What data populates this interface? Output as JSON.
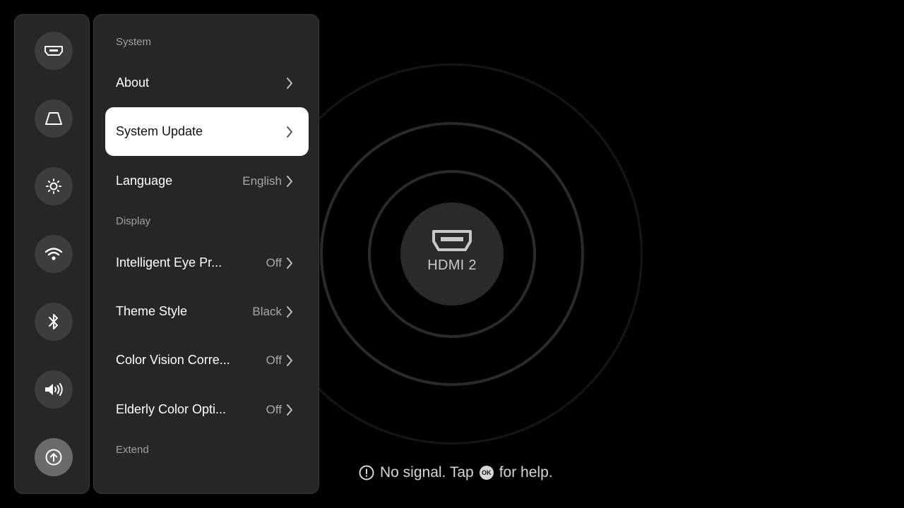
{
  "rail": {
    "buttons": [
      {
        "id": "input",
        "icon": "hdmi-icon"
      },
      {
        "id": "keystone",
        "icon": "keystone-icon"
      },
      {
        "id": "brightness",
        "icon": "brightness-icon"
      },
      {
        "id": "wifi",
        "icon": "wifi-icon"
      },
      {
        "id": "bluetooth",
        "icon": "bluetooth-icon"
      },
      {
        "id": "sound",
        "icon": "speaker-icon"
      },
      {
        "id": "system",
        "icon": "arrow-up-circle-icon",
        "active": true
      }
    ]
  },
  "panel": {
    "sections": {
      "system": "System",
      "display": "Display",
      "extend": "Extend"
    },
    "items": {
      "about": {
        "label": "About"
      },
      "system_update": {
        "label": "System Update",
        "selected": true
      },
      "language": {
        "label": "Language",
        "value": "English"
      },
      "eye_protection": {
        "label": "Intelligent Eye Pr...",
        "value": "Off"
      },
      "theme_style": {
        "label": "Theme Style",
        "value": "Black"
      },
      "color_vision": {
        "label": "Color Vision Corre...",
        "value": "Off"
      },
      "elderly_color": {
        "label": "Elderly Color Opti...",
        "value": "Off"
      }
    }
  },
  "source": {
    "label": "HDMI 2",
    "icon": "hdmi-port-icon"
  },
  "status": {
    "prefix": "No signal. Tap",
    "key": "OK",
    "suffix": "for help."
  },
  "colors": {
    "background": "#000000",
    "panel": "#262626",
    "rail_button": "#3d3d3d",
    "rail_button_active": "#6a6a6a",
    "selected_item": "#ffffff"
  }
}
